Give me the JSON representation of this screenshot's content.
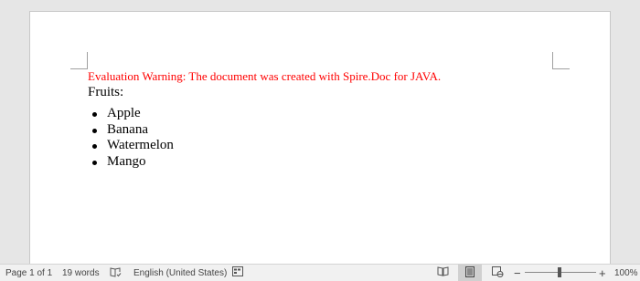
{
  "document": {
    "warning": "Evaluation Warning: The document was created with Spire.Doc for JAVA.",
    "heading": "Fruits:",
    "items": [
      "Apple",
      "Banana",
      "Watermelon",
      "Mango"
    ]
  },
  "statusbar": {
    "page_info": "Page 1 of 1",
    "word_count": "19 words",
    "language": "English (United States)",
    "zoom_minus": "−",
    "zoom_plus": "+",
    "zoom_level": "100%"
  },
  "colors": {
    "warning_text": "#ff0000",
    "workspace_bg": "#e6e6e6",
    "page_bg": "#ffffff",
    "statusbar_bg": "#f1f1f1"
  },
  "icons": [
    "proofing-icon",
    "macro-record-icon",
    "read-mode-icon",
    "print-layout-icon",
    "web-layout-icon"
  ]
}
